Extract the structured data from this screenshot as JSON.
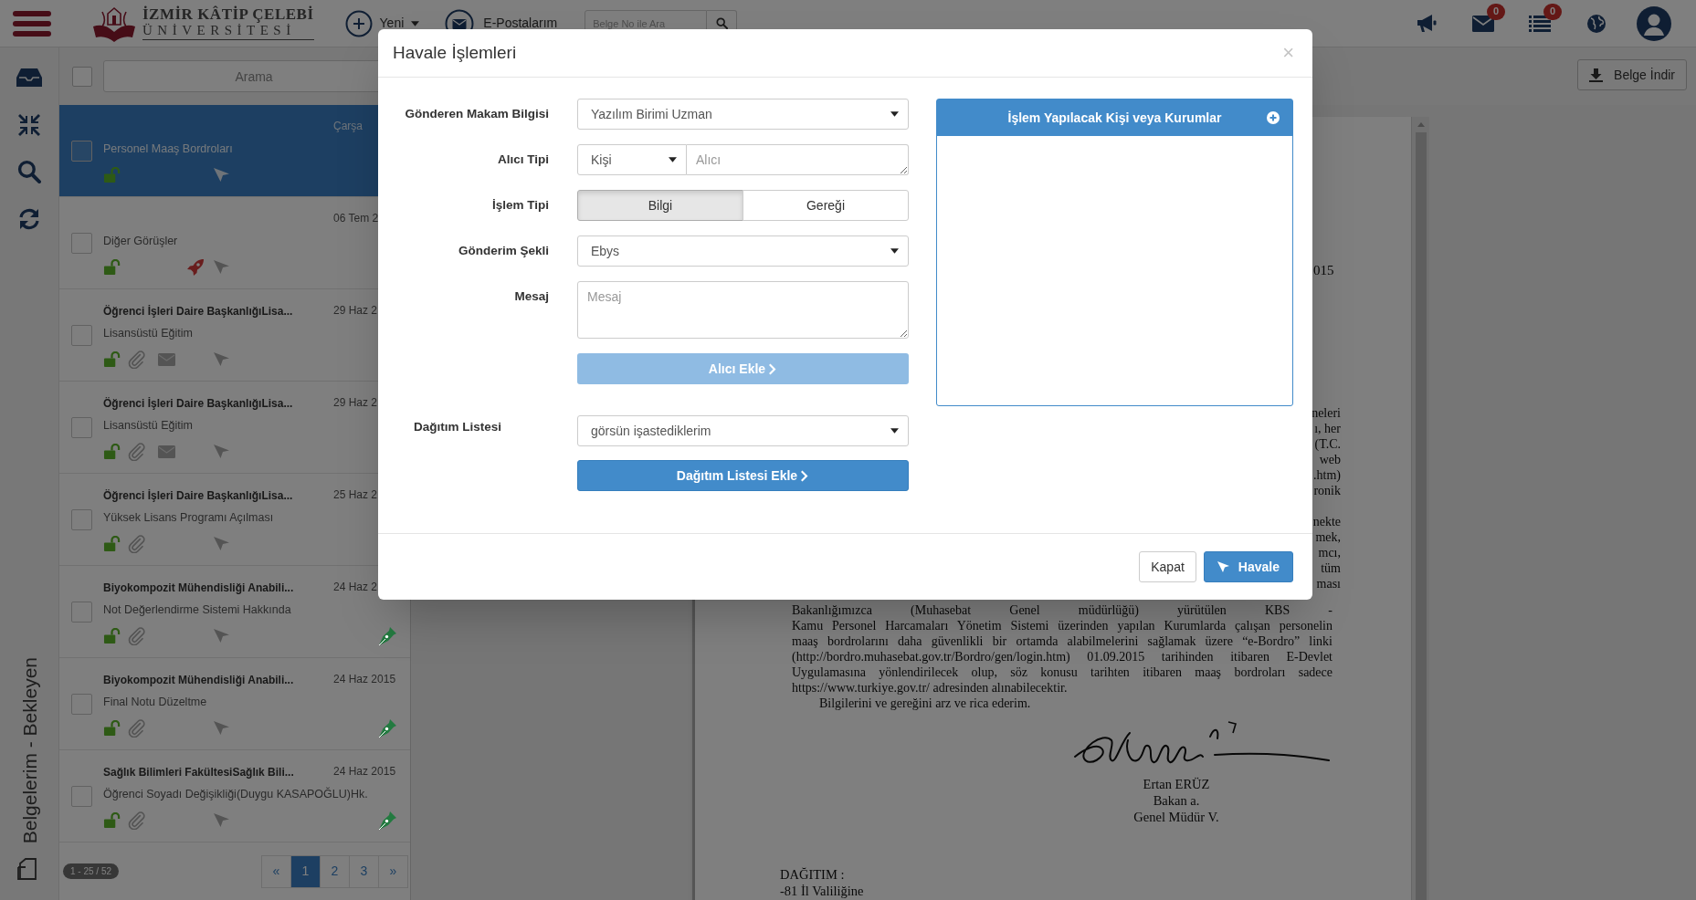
{
  "topbar": {
    "logo": {
      "line1": "İZMİR KÂTİP ÇELEBİ",
      "line2": "ÜNİVERSİTESİ"
    },
    "new_label": "Yeni",
    "mail_label": "E-Postalarım",
    "search_placeholder": "Belge No ile Ara",
    "mail_badge": "0",
    "tasks_badge": "0"
  },
  "sidebar": {
    "vertical_title": "Belgelerim - Bekleyen"
  },
  "list": {
    "search_placeholder": "Arama",
    "select_all_checked": false,
    "items": [
      {
        "date": "Çarşa",
        "subject": "Personel Maaş Bordroları",
        "selected": true,
        "checked": false,
        "attachment": false,
        "mail": false,
        "urgent": false
      },
      {
        "date": "06 Tem 2",
        "subject": "Diğer Görüşler",
        "selected": false,
        "checked": false,
        "attachment": false,
        "mail": false,
        "urgent": true
      },
      {
        "title": "Öğrenci İşleri Daire BaşkanlığıLisa...",
        "date": "29 Haz 2",
        "subject": "Lisansüstü Eğitim",
        "selected": false,
        "checked": false,
        "attachment": true,
        "mail": true,
        "urgent": false
      },
      {
        "title": "Öğrenci İşleri Daire BaşkanlığıLisa...",
        "date": "29 Haz 2",
        "subject": "Lisansüstü Eğitim",
        "selected": false,
        "checked": false,
        "attachment": true,
        "mail": true,
        "urgent": false
      },
      {
        "title": "Öğrenci İşleri Daire BaşkanlığıLisa...",
        "date": "25 Haz 2",
        "subject": "Yüksek Lisans Programı Açılması",
        "selected": false,
        "checked": false,
        "attachment": true,
        "mail": false,
        "urgent": false
      },
      {
        "title": "Biyokompozit Mühendisliği Anabili...",
        "date": "24 Haz 2",
        "subject": "Not Değerlendirme Sistemi Hakkında",
        "selected": false,
        "checked": false,
        "attachment": true,
        "mail": false,
        "urgent": false,
        "color": "#237a40"
      },
      {
        "title": "Biyokompozit Mühendisliği Anabili...",
        "date": "24 Haz 2015",
        "subject": "Final Notu Düzeltme",
        "selected": false,
        "checked": false,
        "attachment": true,
        "mail": false,
        "urgent": false,
        "color": "#237a40"
      },
      {
        "title": "Sağlık Bilimleri FakültesiSağlık Bili...",
        "date": "24 Haz 2015",
        "subject": "Öğrenci Soyadı Değişikliği(Duygu KASAPOĞLU)Hk.",
        "selected": false,
        "checked": false,
        "attachment": true,
        "mail": false,
        "urgent": false,
        "color": "#237a40"
      }
    ],
    "counter": "1 - 25 / 52",
    "pagination": [
      {
        "label": "«",
        "selected": false
      },
      {
        "label": "1",
        "selected": true
      },
      {
        "label": "2",
        "selected": false
      },
      {
        "label": "3",
        "selected": false
      },
      {
        "label": "»",
        "selected": false
      }
    ]
  },
  "viewer": {
    "download_label": "Belge İndir",
    "document": {
      "date_fragment": "015",
      "fragments_top": [
        "neleri",
        "ı, her",
        "(T.C.",
        "web",
        ".htm)",
        "ronik"
      ],
      "fragments_bottom": [
        "nekte",
        "mek,",
        "mcı,",
        "tüm",
        "ması"
      ],
      "paragraph_lines": [
        "Bakanlığımızca (Muhasebat Genel müdürlüğü) yürütülen KBS -",
        "Kamu Personel Harcamaları Yönetim Sistemi üzerinden yapılan Kurumlarda çalışan personelin",
        "maaş bordrolarını daha güvenlikli bir ortamda alabilmelerini sağlamak üzere “e-Bordro” linki",
        "(http://bordro.muhasebat.gov.tr/Bordro/gen/login.htm) 01.09.2015 tarihinden itibaren E-Devlet",
        "Uygulamasına yönlendirilecek olup, söz konusu tarihten itibaren maaş bordroları sadece",
        "https://www.turkiye.gov.tr/ adresinden alınabilecektir."
      ],
      "closing": "Bilgilerini ve gereğini arz ve rica ederim.",
      "signatory": [
        "Ertan ERÜZ",
        "Bakan a.",
        "Genel Müdür V."
      ],
      "distribution_heading": "DAĞITIM :",
      "distribution": [
        "-81 İl Valiliğine"
      ]
    }
  },
  "modal": {
    "title": "Havale İşlemleri",
    "close": "×",
    "fields": [
      {
        "kind": "select",
        "label": "Gönderen Makam Bilgisi",
        "value": "Yazılım Birimi Uzman"
      },
      {
        "kind": "select-input",
        "label": "Alıcı Tipi",
        "value": "Kişi",
        "placeholder": "Alıcı"
      },
      {
        "kind": "toggle",
        "label": "İşlem Tipi",
        "options": [
          {
            "label": "Bilgi",
            "selected": true
          },
          {
            "label": "Gereği",
            "selected": false
          }
        ]
      },
      {
        "kind": "select",
        "label": "Gönderim Şekli",
        "value": "Ebys"
      },
      {
        "kind": "textarea",
        "label": "Mesaj",
        "placeholder": "Mesaj"
      },
      {
        "kind": "button",
        "label": "Alıcı Ekle",
        "disabled": true
      }
    ],
    "distribution": {
      "label": "Dağıtım Listesi",
      "value": "görsün işastediklerim",
      "button": "Dağıtım Listesi Ekle"
    },
    "recipients_panel": {
      "title": "İşlem Yapılacak Kişi veya Kurumlar"
    },
    "buttons": [
      {
        "kind": "secondary",
        "label": "Kapat"
      },
      {
        "kind": "primary",
        "label": "Havale"
      }
    ]
  }
}
